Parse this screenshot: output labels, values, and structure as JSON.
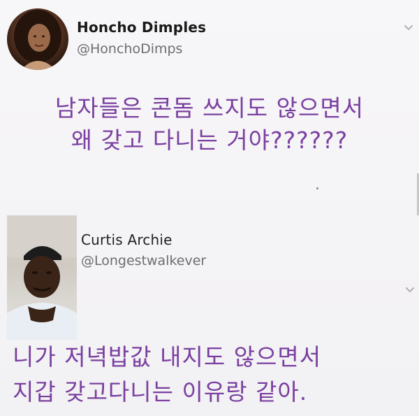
{
  "tweets": [
    {
      "author": {
        "name": "Honcho Dimples",
        "handle": "@HonchoDimps"
      },
      "text_lines": [
        "남자들은 콘돔 쓰지도 않으면서",
        "왜 갖고 다니는 거야??????"
      ],
      "menu_icon": "chevron-down-icon"
    },
    {
      "author": {
        "name": "Curtis Archie",
        "handle": "@Longestwalkever"
      },
      "text_lines": [
        "니가 저녁밥값 내지도 않으면서",
        "지갑 갖고다니는 이유랑 같아."
      ],
      "menu_icon": "chevron-down-icon"
    }
  ],
  "colors": {
    "tweet_text": "#7a3fa0",
    "name_text": "#1a1a1a",
    "handle_text": "#6d6d72",
    "background": "#f5f4f6"
  }
}
